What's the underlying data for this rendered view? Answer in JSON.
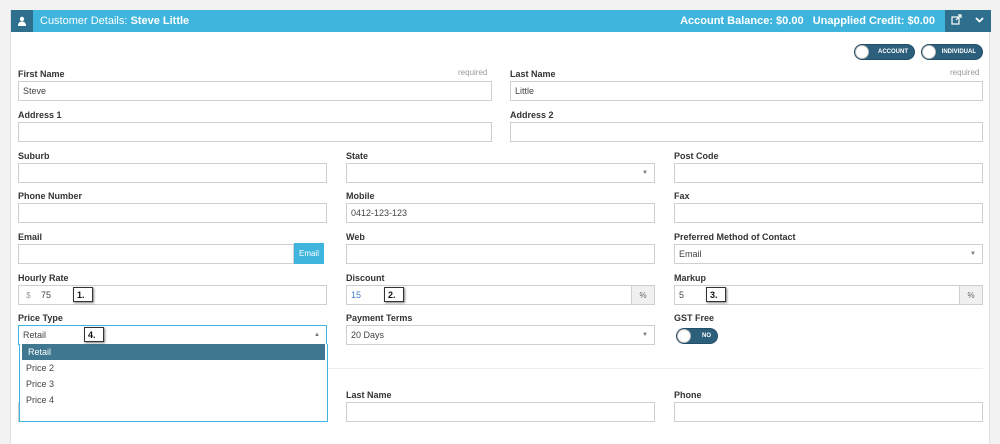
{
  "header": {
    "title_prefix": "Customer Details: ",
    "customer_name": "Steve Little",
    "balance_text": "Account Balance: $0.00   Unapplied Credit: $0.00"
  },
  "toggles": {
    "account": "ACCOUNT",
    "individual": "INDIVIDUAL"
  },
  "form": {
    "first_name": {
      "label": "First Name",
      "value": "Steve",
      "required": "required"
    },
    "last_name": {
      "label": "Last Name",
      "value": "Little",
      "required": "required"
    },
    "address1": {
      "label": "Address 1",
      "value": ""
    },
    "address2": {
      "label": "Address 2",
      "value": ""
    },
    "suburb": {
      "label": "Suburb",
      "value": ""
    },
    "state": {
      "label": "State",
      "value": ""
    },
    "post_code": {
      "label": "Post Code",
      "value": ""
    },
    "phone_number": {
      "label": "Phone Number",
      "value": ""
    },
    "mobile": {
      "label": "Mobile",
      "value": "0412-123-123"
    },
    "fax": {
      "label": "Fax",
      "value": ""
    },
    "email": {
      "label": "Email",
      "value": "",
      "button": "Email"
    },
    "web": {
      "label": "Web",
      "value": ""
    },
    "preferred_contact": {
      "label": "Preferred Method of Contact",
      "value": "Email"
    },
    "hourly_rate": {
      "label": "Hourly Rate",
      "prefix": "$",
      "value": "75"
    },
    "discount": {
      "label": "Discount",
      "value": "15",
      "suffix": "%"
    },
    "markup": {
      "label": "Markup",
      "value": "5",
      "suffix": "%"
    },
    "price_type": {
      "label": "Price Type",
      "value": "Retail",
      "options": [
        "Retail",
        "Price 2",
        "Price 3",
        "Price 4"
      ]
    },
    "payment_terms": {
      "label": "Payment Terms",
      "value": "20 Days"
    },
    "gst_free": {
      "label": "GST Free",
      "toggle": "NO"
    }
  },
  "contact": {
    "last_name": {
      "label": "Last Name",
      "value": ""
    },
    "phone": {
      "label": "Phone",
      "value": ""
    }
  },
  "annotations": [
    "1.",
    "2.",
    "3.",
    "4."
  ],
  "colors": {
    "accent": "#3fb5dd",
    "dark": "#2d6f8c",
    "selected": "#3f7791"
  }
}
